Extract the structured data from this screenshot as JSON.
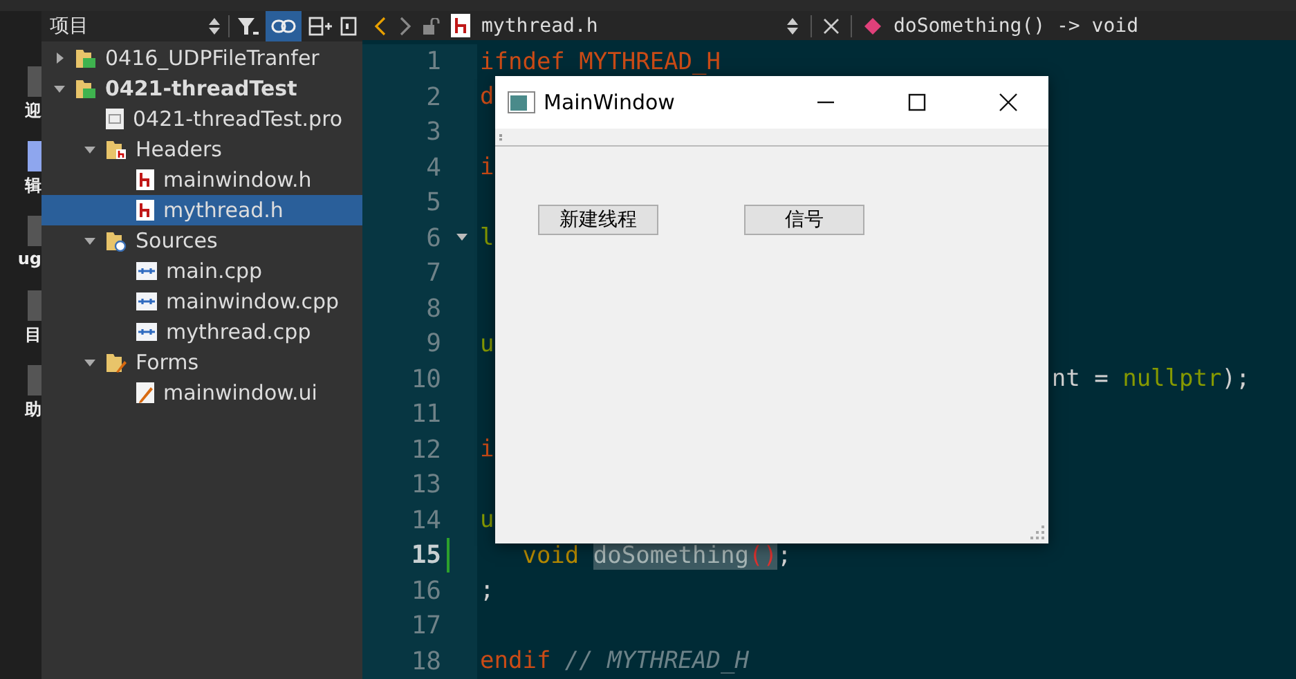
{
  "mode_bar": [
    {
      "label": "迎",
      "selected": false
    },
    {
      "label": "辑",
      "selected": true
    },
    {
      "label": "ug",
      "selected": false
    },
    {
      "label": "目",
      "selected": false
    },
    {
      "label": "助",
      "selected": false
    }
  ],
  "project_panel": {
    "title": "项目",
    "link_enabled": true,
    "tree": [
      {
        "label": "0416_UDPFileTranfer",
        "kind": "project",
        "expanded": false,
        "selected": false
      },
      {
        "label": "0421-threadTest",
        "kind": "project",
        "expanded": true,
        "selected": false,
        "children": [
          {
            "label": "0421-threadTest.pro",
            "kind": "pro",
            "selected": false
          },
          {
            "label": "Headers",
            "kind": "headers",
            "expanded": true,
            "selected": false,
            "children": [
              {
                "label": "mainwindow.h",
                "kind": "header",
                "selected": false
              },
              {
                "label": "mythread.h",
                "kind": "header",
                "selected": true
              }
            ]
          },
          {
            "label": "Sources",
            "kind": "sources",
            "expanded": true,
            "selected": false,
            "children": [
              {
                "label": "main.cpp",
                "kind": "cpp",
                "selected": false
              },
              {
                "label": "mainwindow.cpp",
                "kind": "cpp",
                "selected": false
              },
              {
                "label": "mythread.cpp",
                "kind": "cpp",
                "selected": false
              }
            ]
          },
          {
            "label": "Forms",
            "kind": "forms",
            "expanded": true,
            "selected": false,
            "children": [
              {
                "label": "mainwindow.ui",
                "kind": "ui",
                "selected": false
              }
            ]
          }
        ]
      }
    ]
  },
  "editor": {
    "file": "mythread.h",
    "symbol": "doSomething() -> void",
    "lines": [
      {
        "number": "1",
        "current": false,
        "segments": [
          {
            "text": "ifndef MYTHREAD_H",
            "kind": "directive"
          }
        ]
      },
      {
        "number": "2",
        "current": false,
        "segments": [
          {
            "text": "d",
            "kind": "directive"
          }
        ]
      },
      {
        "number": "3",
        "current": false
      },
      {
        "number": "4",
        "current": false,
        "segments": [
          {
            "text": "i",
            "kind": "directive"
          }
        ]
      },
      {
        "number": "5",
        "current": false
      },
      {
        "number": "6",
        "current": false,
        "foldable": true,
        "segments": [
          {
            "text": "l",
            "kind": "keyword"
          }
        ]
      },
      {
        "number": "7",
        "current": false
      },
      {
        "number": "8",
        "current": false
      },
      {
        "number": "9",
        "current": false,
        "segments": [
          {
            "text": "u",
            "kind": "keyword"
          }
        ]
      },
      {
        "number": "10",
        "current": false,
        "start_hidden": true,
        "segments": [
          {
            "text": "nt = ",
            "kind": "plain"
          },
          {
            "text": "nullptr",
            "kind": "keyword"
          },
          {
            "text": ");",
            "kind": "plain"
          }
        ]
      },
      {
        "number": "11",
        "current": false
      },
      {
        "number": "12",
        "current": false,
        "segments": [
          {
            "text": "i",
            "kind": "directive"
          }
        ]
      },
      {
        "number": "13",
        "current": false
      },
      {
        "number": "14",
        "current": false,
        "segments": [
          {
            "text": "u",
            "kind": "keyword"
          }
        ]
      },
      {
        "number": "15",
        "current": true,
        "changed": true,
        "indented": true,
        "segments": [
          {
            "text": "void ",
            "kind": "type"
          },
          {
            "text": "doSomething",
            "kind": "selected"
          },
          {
            "text": "()",
            "kind": "selected-paren"
          },
          {
            "text": ";",
            "kind": "plain"
          }
        ]
      },
      {
        "number": "16",
        "current": false,
        "segments": [
          {
            "text": ";",
            "kind": "plain"
          }
        ]
      },
      {
        "number": "17",
        "current": false
      },
      {
        "number": "18",
        "current": false,
        "segments": [
          {
            "text": "endif",
            "kind": "directive"
          },
          {
            "text": " // MYTHREAD_H",
            "kind": "comment"
          }
        ]
      }
    ]
  },
  "app_window": {
    "title": "MainWindow",
    "buttons": [
      "新建线程",
      "信号"
    ]
  }
}
